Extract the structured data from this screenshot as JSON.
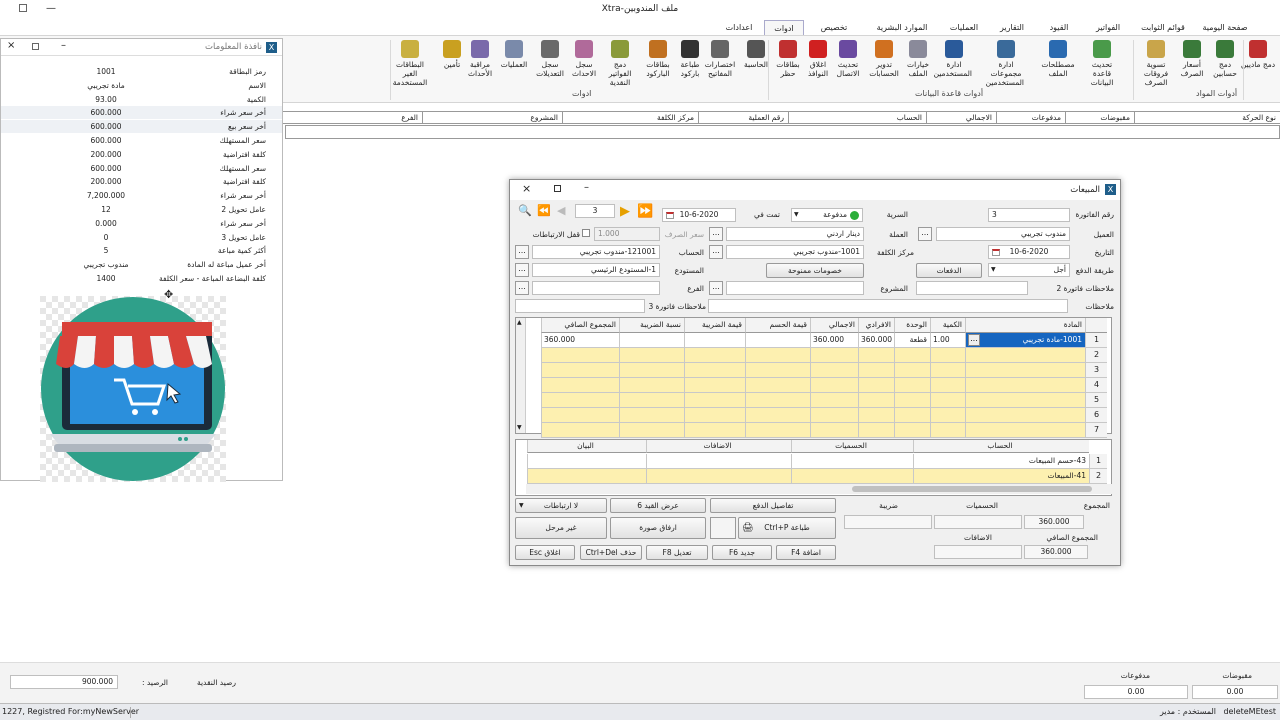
{
  "window": {
    "title": "Xtra-ملف المندوبين"
  },
  "ribbon_tabs": [
    "صفحة اليومية",
    "قوائم الثوابت",
    "الفواتير",
    "القيود",
    "التقارير",
    "العمليات",
    "الموارد البشرية",
    "تخصيص",
    "ادوات",
    "اعدادات"
  ],
  "ribbon_active_tab": "ادوات",
  "ribbon_groups": {
    "materials_tools": "أدوات المواد",
    "db_tools": "أدوات قاعدة البيانات",
    "tools": "ادوات"
  },
  "ribbon_buttons": [
    {
      "label": "دمج ماديين",
      "icon": "merge-icon",
      "color": "#c03030"
    },
    {
      "label": "دمج حسابين",
      "icon": "merge-accounts-icon",
      "color": "#3a7a3a"
    },
    {
      "label": "أسعار الصرف",
      "icon": "exchange-rates-icon",
      "color": "#3a7a3a"
    },
    {
      "label": "تسوية فروقات الصرف",
      "icon": "settlement-icon",
      "color": "#c9a54a"
    },
    {
      "label": "تحديث قاعدة البيانات",
      "icon": "refresh-db-icon",
      "color": "#4a9a4a"
    },
    {
      "label": "مصطلحات الملف",
      "icon": "terms-icon",
      "color": "#2a6ab0"
    },
    {
      "label": "ادارة مجموعات المستخدمين",
      "icon": "user-groups-icon",
      "color": "#3a6a9a"
    },
    {
      "label": "ادارة المستخدمين",
      "icon": "users-icon",
      "color": "#2a5a9a"
    },
    {
      "label": "خيارات الملف",
      "icon": "file-options-icon",
      "color": "#8a8a9a"
    },
    {
      "label": "تدوير الحسابات",
      "icon": "rotate-accounts-icon",
      "color": "#d07020"
    },
    {
      "label": "تحديث الاتصال",
      "icon": "connection-icon",
      "color": "#6a4aa0"
    },
    {
      "label": "اغلاق النوافذ",
      "icon": "close-windows-icon",
      "color": "#d02020"
    },
    {
      "label": "بطاقات حظر",
      "icon": "block-cards-icon",
      "color": "#c03030"
    },
    {
      "label": "الحاسبة",
      "icon": "calculator-icon",
      "color": "#555555"
    },
    {
      "label": "اختصارات المفاتيح",
      "icon": "shortcuts-icon",
      "color": "#666666"
    },
    {
      "label": "طباعة باركود",
      "icon": "barcode-print-icon",
      "color": "#333333"
    },
    {
      "label": "بطاقات الباركود",
      "icon": "barcode-cards-icon",
      "color": "#c07020"
    },
    {
      "label": "دمج الفواتير النقدية",
      "icon": "merge-invoices-icon",
      "color": "#8a9a3a"
    },
    {
      "label": "سجل الاحداث",
      "icon": "events-log-icon",
      "color": "#b06a9a"
    },
    {
      "label": "سجل التعديلات",
      "icon": "edits-log-icon",
      "color": "#6a6a6a"
    },
    {
      "label": "العمليات",
      "icon": "operations-icon",
      "color": "#7a8aaa"
    },
    {
      "label": "مراقبة الأحداث",
      "icon": "monitor-icon",
      "color": "#7a6aaa"
    },
    {
      "label": "تأمين",
      "icon": "lock-icon",
      "color": "#c9a020"
    },
    {
      "label": "البطاقات الغير المستخدمة",
      "icon": "unused-cards-icon",
      "color": "#c9b040"
    }
  ],
  "bg_table": {
    "headers": [
      "نوع الحركة",
      "مقبوضات",
      "مدفوعات",
      "الاجمالي",
      "الحساب",
      "رقم العملية",
      "مركز الكلفة",
      "المشروع",
      "الفرع"
    ]
  },
  "info_panel": {
    "title": "نافذة المعلومات",
    "rows": [
      {
        "label": "رمز البطاقة",
        "value": "1001"
      },
      {
        "label": "الاسم",
        "value": "مادة تجريبي"
      },
      {
        "label": "الكمية",
        "value": "93.00"
      },
      {
        "label": "أخر سعر شراء",
        "value": "600.000"
      },
      {
        "label": "أخر سعر بيع",
        "value": "600.000"
      },
      {
        "label": "سعر المستهلك",
        "value": "600.000"
      },
      {
        "label": "كلفة افتراضية",
        "value": "200.000"
      },
      {
        "label": "سعر المستهلك",
        "value": "600.000"
      },
      {
        "label": "كلفة افتراضية",
        "value": "200.000"
      },
      {
        "label": "أخر سعر شراء",
        "value": "7,200.000"
      },
      {
        "label": "عامل تحويل 2",
        "value": "12"
      },
      {
        "label": "أخر سعر شراء",
        "value": "0.000"
      },
      {
        "label": "عامل تحويل 3",
        "value": "0"
      },
      {
        "label": "أكثر كمية مباعة",
        "value": "5"
      },
      {
        "label": "أخر عميل مباعة له المادة",
        "value": "مندوب تجريبي"
      },
      {
        "label": "كلفة البضاعة المباعة - سعر الكلفة",
        "value": "1400"
      }
    ]
  },
  "dialog": {
    "title": "المبيعات",
    "invoice_no_label": "رقم الفاتورة",
    "invoice_no": "3",
    "series_label": "السرية",
    "status": "مدفوعة",
    "status_label": "تمت في",
    "date_top": "10-6-2020",
    "nav_counter": "3",
    "customer_label": "العميل",
    "customer": "مندوب تجريبي",
    "currency_label": "العملة",
    "currency": "دينار اردني",
    "rate_label": "سعر الصرف",
    "rate": "1.000",
    "lock_links_label": "قفل الارتباطات",
    "date_label": "التاريخ",
    "date": "10-6-2020",
    "cost_center_label": "مركز الكلفة",
    "cost_center": "1001-مندوب تجريبي",
    "account_label": "الحساب",
    "account": "121001-مندوب تجريبي",
    "payment_method_label": "طريقة الدفع",
    "payment_method": "أجل",
    "payments_btn": "الدفعات",
    "discounts_btn": "خصومات ممنوحة",
    "warehouse_label": "المستودع",
    "warehouse": "1-المستودع الرئيسي",
    "notes2_label": "ملاحظات فاتورة 2",
    "project_label": "المشروع",
    "branch_label": "الفرع",
    "notes_label": "ملاحظات",
    "notes3_label": "ملاحظات فاتورة 3",
    "grid_headers": [
      "المادة",
      "الكمية",
      "الوحدة",
      "الافرادي",
      "الاجمالي",
      "قيمة الحسم",
      "قيمة الضريبة",
      "نسبة الضريبة",
      "المجموع الصافي"
    ],
    "grid_row1": {
      "item": "1001-مادة تجريبي",
      "qty": "1.00",
      "unit": "قطعة",
      "unit_price": "360.000",
      "total": "360.000",
      "net": "360.000"
    },
    "row_numbers": [
      "1",
      "2",
      "3",
      "4",
      "5",
      "6",
      "7"
    ],
    "grid2_headers": [
      "الحساب",
      "الحسميات",
      "الاضافات",
      "البيان"
    ],
    "grid2_rows": [
      {
        "account": "43-حسم المبيعات"
      },
      {
        "account": "41-المبيعات"
      }
    ],
    "grid2_row_numbers": [
      "1",
      "2"
    ],
    "totals": {
      "total_label": "المجموع",
      "total": "360.000",
      "tax_label": "ضريبة",
      "discounts_label": "الحسميات",
      "additions_label": "الاضافات",
      "net_label": "المجموع الصافي",
      "net": "360.000"
    },
    "buttons": {
      "payment_details": "تفاصيل الدفع",
      "show_entry": "عرض القيد 6",
      "unlinked": "لا ارتباطات",
      "print": "طباعة Ctrl+P",
      "attach": "ارفاق صورة",
      "unposted": "غير مرحل",
      "add": "اضافة F4",
      "new": "جديد F6",
      "edit": "تعديل F8",
      "delete": "حذف Ctrl+Del",
      "close": "اغلاق Esc"
    }
  },
  "footer": {
    "cash_balance_label": "رصيد النقدية",
    "balance_label": "الرصيد :",
    "balance": "900.000",
    "receipts_label": "مقبوضات",
    "receipts": "0.00",
    "payments_label": "مدفوعات",
    "payments": "0.00"
  },
  "statusbar": {
    "left": "1227, Registred For:myNewServer",
    "user_label": "المستخدم : مدير",
    "right": "deleteMEtest"
  }
}
